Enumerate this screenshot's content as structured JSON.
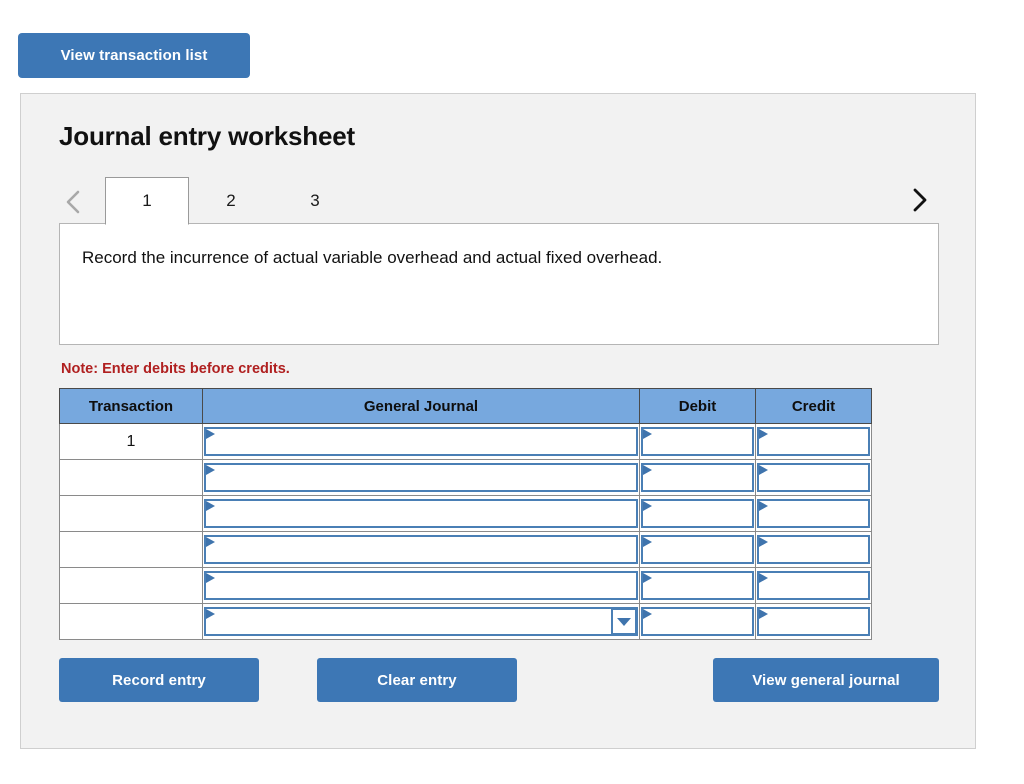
{
  "top": {
    "view_transaction_list_label": "View transaction list"
  },
  "worksheet": {
    "title": "Journal entry worksheet",
    "prev_icon": "chevron-left-icon",
    "next_icon": "chevron-right-icon",
    "tabs": [
      {
        "label": "1",
        "active": true
      },
      {
        "label": "2",
        "active": false
      },
      {
        "label": "3",
        "active": false
      }
    ],
    "instruction": "Record the incurrence of actual variable overhead and actual fixed overhead.",
    "note": "Note: Enter debits before credits."
  },
  "table": {
    "columns": [
      "Transaction",
      "General Journal",
      "Debit",
      "Credit"
    ],
    "rows": [
      {
        "transaction": "1",
        "journal": "",
        "debit": "",
        "credit": "",
        "dropdown": false
      },
      {
        "transaction": "",
        "journal": "",
        "debit": "",
        "credit": "",
        "dropdown": false
      },
      {
        "transaction": "",
        "journal": "",
        "debit": "",
        "credit": "",
        "dropdown": false
      },
      {
        "transaction": "",
        "journal": "",
        "debit": "",
        "credit": "",
        "dropdown": false
      },
      {
        "transaction": "",
        "journal": "",
        "debit": "",
        "credit": "",
        "dropdown": false
      },
      {
        "transaction": "",
        "journal": "",
        "debit": "",
        "credit": "",
        "dropdown": true
      }
    ]
  },
  "actions": {
    "record_entry_label": "Record entry",
    "clear_entry_label": "Clear entry",
    "view_general_journal_label": "View general journal"
  },
  "colors": {
    "button_blue": "#3d77b5",
    "header_blue": "#77a8de",
    "field_border_blue": "#4a7fb5",
    "note_red": "#b02020",
    "panel_bg": "#f2f2f2"
  }
}
